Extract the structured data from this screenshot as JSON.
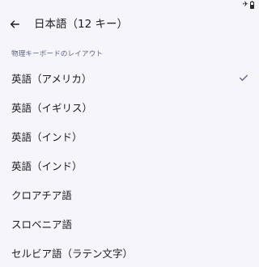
{
  "header": {
    "title": "日本語（12 キー）"
  },
  "section": {
    "header": "物理キーボードのレイアウト"
  },
  "layouts": [
    {
      "label": "英語（アメリカ）",
      "selected": true
    },
    {
      "label": "英語（イギリス）",
      "selected": false
    },
    {
      "label": "英語（インド）",
      "selected": false
    },
    {
      "label": "英語（インド）",
      "selected": false
    },
    {
      "label": "クロアチア語",
      "selected": false
    },
    {
      "label": "スロベニア語",
      "selected": false
    },
    {
      "label": "セルビア語（ラテン文字）",
      "selected": false
    }
  ],
  "status_bar": {
    "icons": [
      "airplane-icon",
      "battery-icon"
    ],
    "battery_level": 0.5
  },
  "colors": {
    "background": "#f6f5fa",
    "section_header": "#5a5f86",
    "check": "#5a5f86"
  }
}
